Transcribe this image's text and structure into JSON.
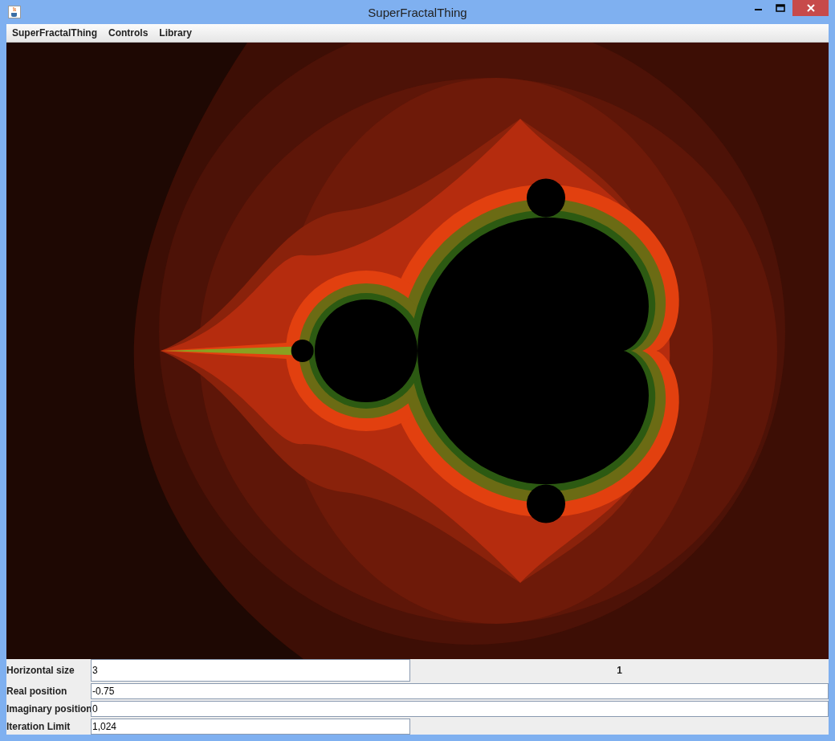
{
  "window": {
    "title": "SuperFractalThing"
  },
  "menu": [
    {
      "label": "SuperFractalThing"
    },
    {
      "label": "Controls"
    },
    {
      "label": "Library"
    }
  ],
  "controls": {
    "status": "1",
    "fields": [
      {
        "label": "Horizontal size",
        "value": "3",
        "kind": "short"
      },
      {
        "label": "Real position",
        "value": "-0.75",
        "kind": "long"
      },
      {
        "label": "Imaginary position",
        "value": "0",
        "kind": "long"
      },
      {
        "label": "Iteration Limit",
        "value": "1,024",
        "kind": "short"
      }
    ]
  }
}
